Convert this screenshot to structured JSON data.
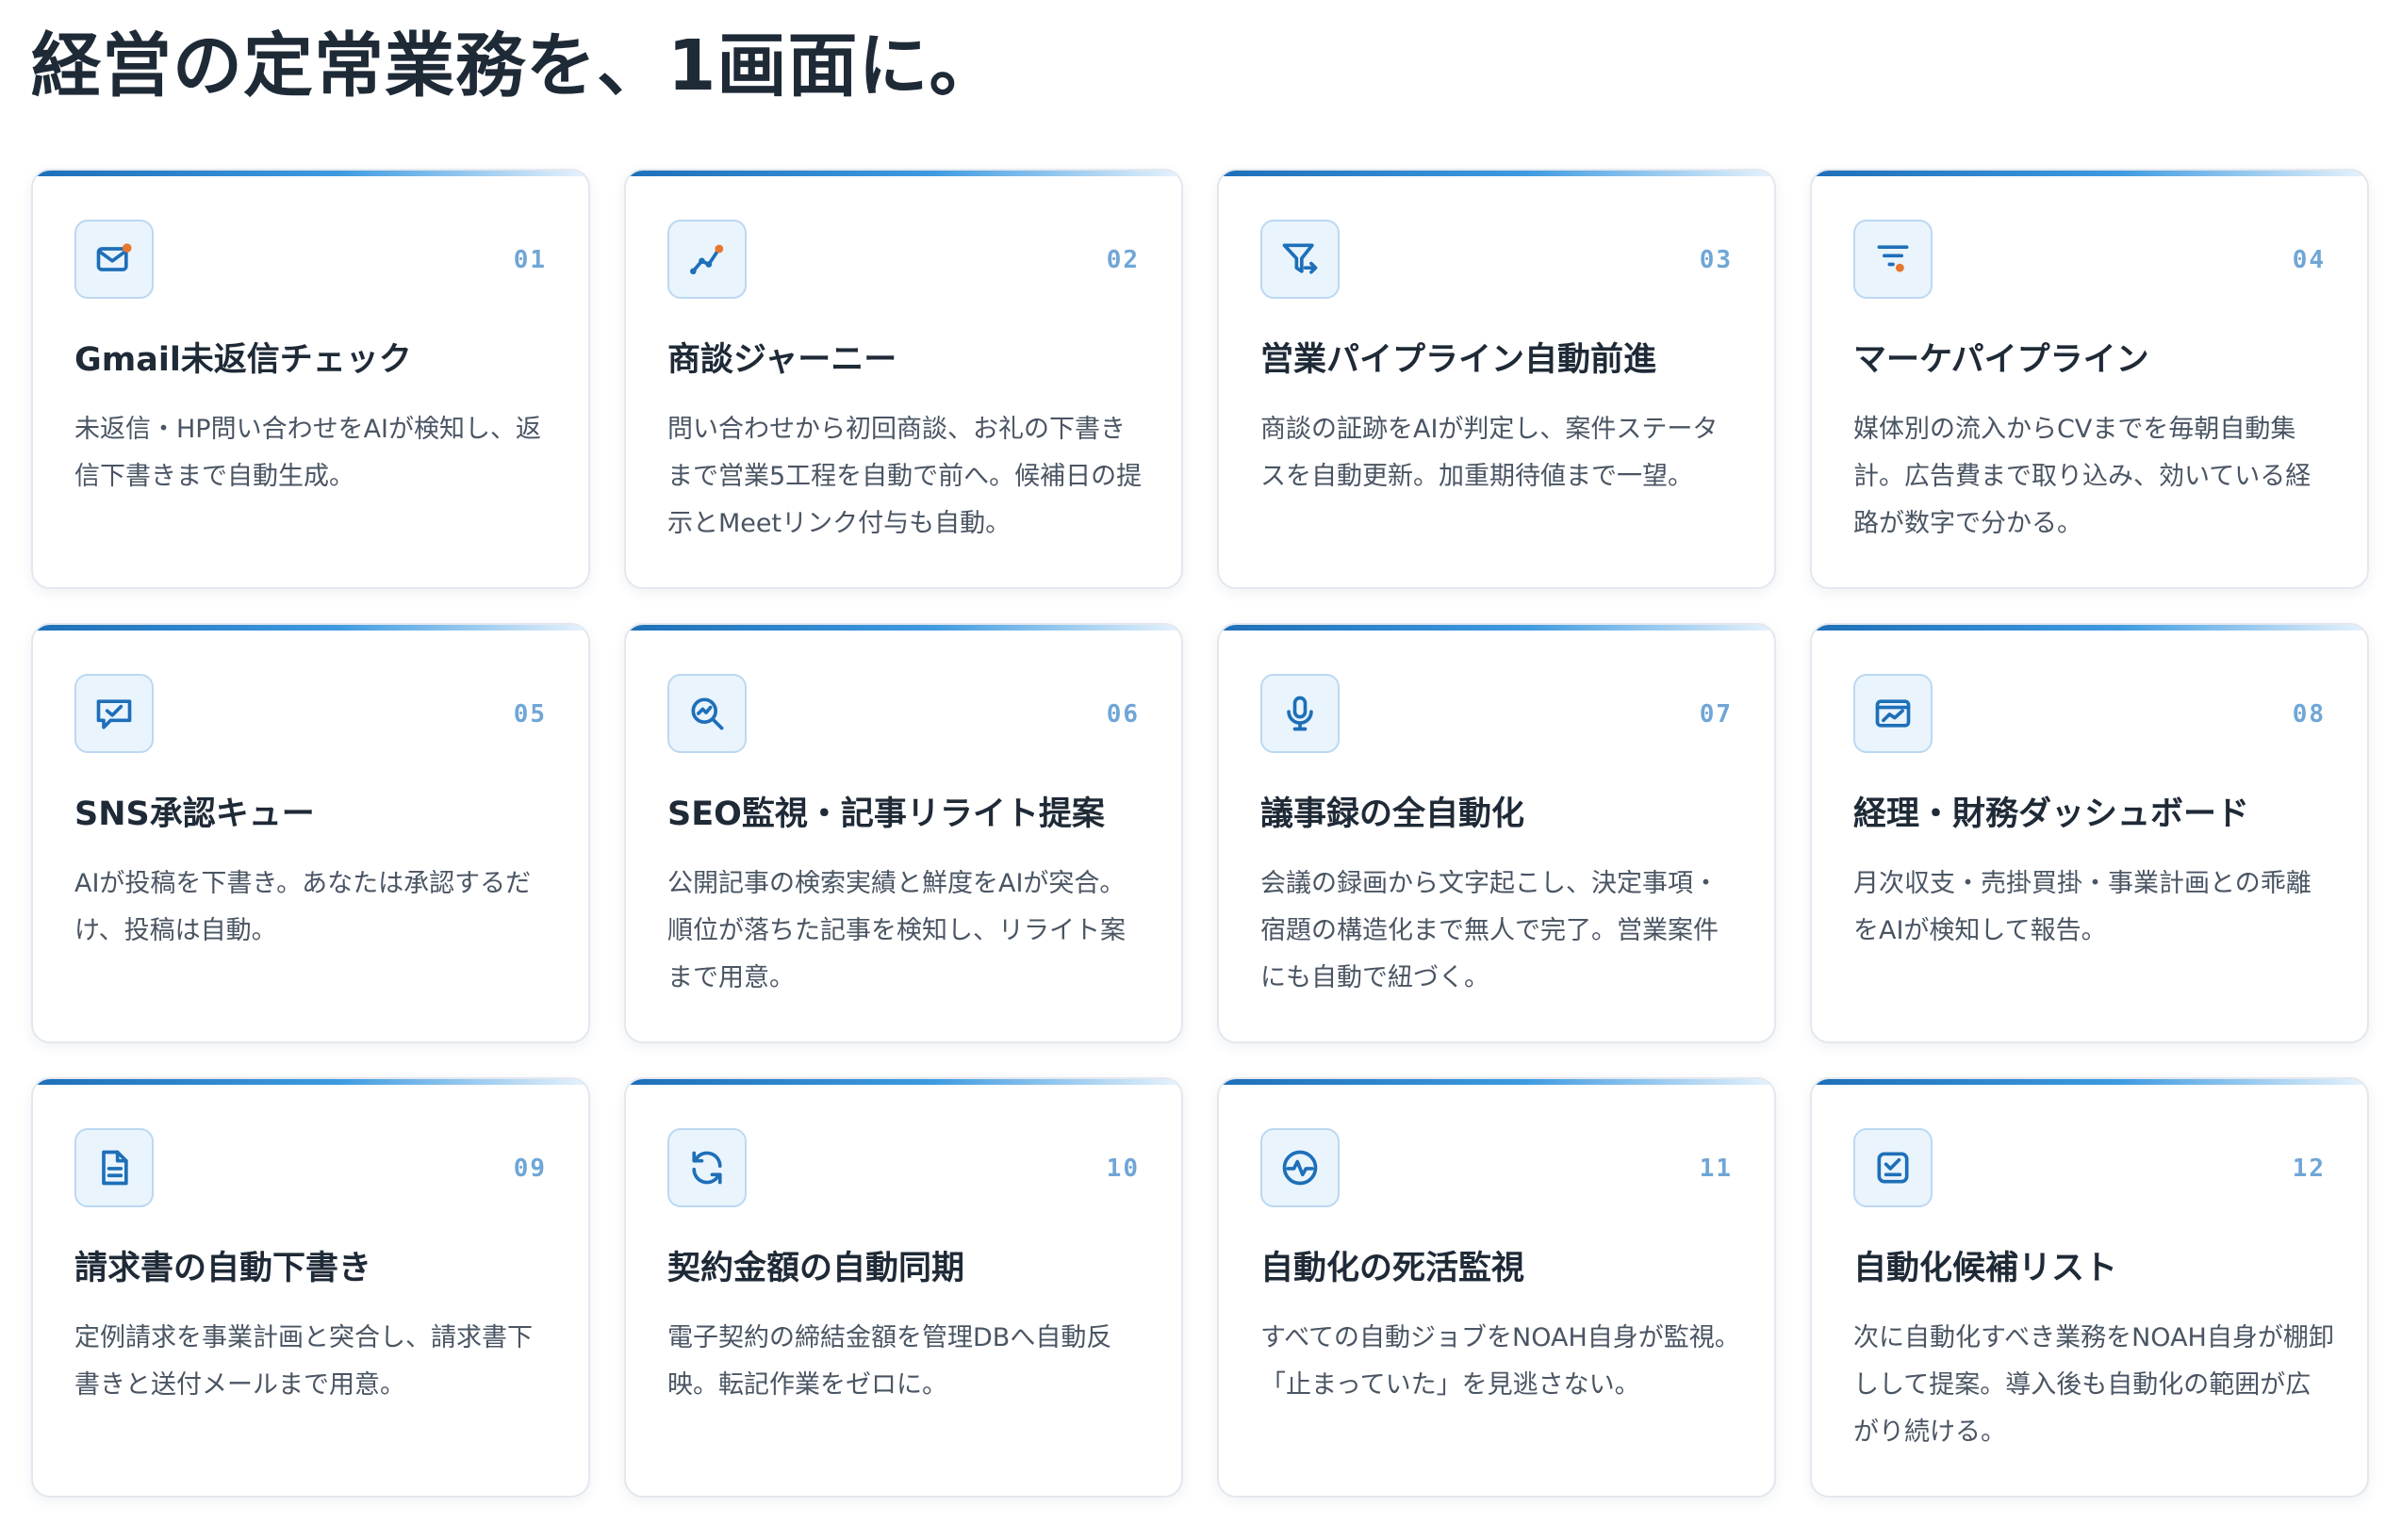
{
  "title": "経営の定常業務を、1画面に。",
  "colors": {
    "accent": "#1e6fb8",
    "icon_stroke": "#1e6fb8",
    "icon_dot": "#e8772e",
    "number": "#6fa6d6"
  },
  "cards": [
    {
      "num": "01",
      "icon": "mail-icon",
      "title": "Gmail未返信チェック",
      "desc": "未返信・HP問い合わせをAIが検知し、返信下書きまで自動生成。"
    },
    {
      "num": "02",
      "icon": "journey-icon",
      "title": "商談ジャーニー",
      "desc": "問い合わせから初回商談、お礼の下書きまで営業5工程を自動で前へ。候補日の提示とMeetリンク付与も自動。"
    },
    {
      "num": "03",
      "icon": "funnel-icon",
      "title": "営業パイプライン自動前進",
      "desc": "商談の証跡をAIが判定し、案件ステータスを自動更新。加重期待値まで一望。"
    },
    {
      "num": "04",
      "icon": "filter-lines-icon",
      "title": "マーケパイプライン",
      "desc": "媒体別の流入からCVまでを毎朝自動集計。広告費まで取り込み、効いている経路が数字で分かる。"
    },
    {
      "num": "05",
      "icon": "chat-check-icon",
      "title": "SNS承認キュー",
      "desc": "AIが投稿を下書き。あなたは承認するだけ、投稿は自動。"
    },
    {
      "num": "06",
      "icon": "search-trend-icon",
      "title": "SEO監視・記事リライト提案",
      "desc": "公開記事の検索実績と鮮度をAIが突合。順位が落ちた記事を検知し、リライト案まで用意。"
    },
    {
      "num": "07",
      "icon": "microphone-icon",
      "title": "議事録の全自動化",
      "desc": "会議の録画から文字起こし、決定事項・宿題の構造化まで無人で完了。営業案件にも自動で紐づく。"
    },
    {
      "num": "08",
      "icon": "chart-window-icon",
      "title": "経理・財務ダッシュボード",
      "desc": "月次収支・売掛買掛・事業計画との乖離をAIが検知して報告。"
    },
    {
      "num": "09",
      "icon": "document-icon",
      "title": "請求書の自動下書き",
      "desc": "定例請求を事業計画と突合し、請求書下書きと送付メールまで用意。"
    },
    {
      "num": "10",
      "icon": "sync-icon",
      "title": "契約金額の自動同期",
      "desc": "電子契約の締結金額を管理DBへ自動反映。転記作業をゼロに。"
    },
    {
      "num": "11",
      "icon": "heartbeat-icon",
      "title": "自動化の死活監視",
      "desc": "すべての自動ジョブをNOAH自身が監視。「止まっていた」を見逃さない。"
    },
    {
      "num": "12",
      "icon": "checklist-icon",
      "title": "自動化候補リスト",
      "desc": "次に自動化すべき業務をNOAH自身が棚卸しして提案。導入後も自動化の範囲が広がり続ける。"
    }
  ]
}
